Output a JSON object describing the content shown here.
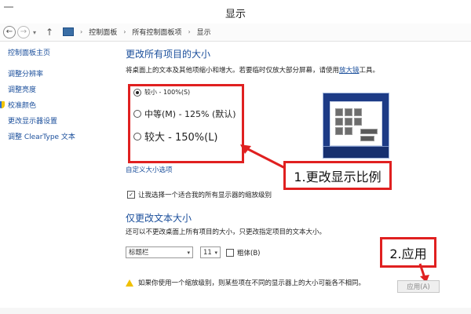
{
  "window": {
    "title": "显示"
  },
  "address": {
    "crumbs": [
      "控制面板",
      "所有控制面板项",
      "显示"
    ],
    "sep": "›"
  },
  "sidebar": {
    "home": "控制面板主页",
    "links": [
      "调整分辨率",
      "调整亮度",
      "校准颜色",
      "更改显示器设置",
      "调整 ClearType 文本"
    ]
  },
  "main": {
    "heading": "更改所有项目的大小",
    "desc_pre": "将桌面上的文本及其他项缩小和增大。若要临时仅放大部分屏幕，请使用",
    "desc_link": "放大镜",
    "desc_post": "工具。",
    "options": [
      {
        "label": "较小 - 100%(S)",
        "checked": true
      },
      {
        "label": "中等(M) - 125% (默认)",
        "checked": false
      },
      {
        "label": "较大 - 150%(L)",
        "checked": false
      }
    ],
    "custom_link": "自定义大小选项",
    "let_choose": "让我选择一个适合我的所有显示器的缩放级别",
    "heading2": "仅更改文本大小",
    "desc2": "还可以不更改桌面上所有项目的大小，只更改指定项目的文本大小。",
    "item_select": "标题栏",
    "size_select": "11",
    "bold_label": "粗体(B)",
    "warning": "如果你使用一个缩放级别，则某些项在不同的显示器上的大小可能各不相同。",
    "apply": "应用(A)"
  },
  "annotations": {
    "callout1": "1.更改显示比例",
    "callout2": "2.应用",
    "color": "#e02020"
  },
  "icons": [
    "back-icon",
    "forward-icon",
    "up-icon",
    "monitor-icon",
    "shield-icon",
    "warning-icon"
  ]
}
